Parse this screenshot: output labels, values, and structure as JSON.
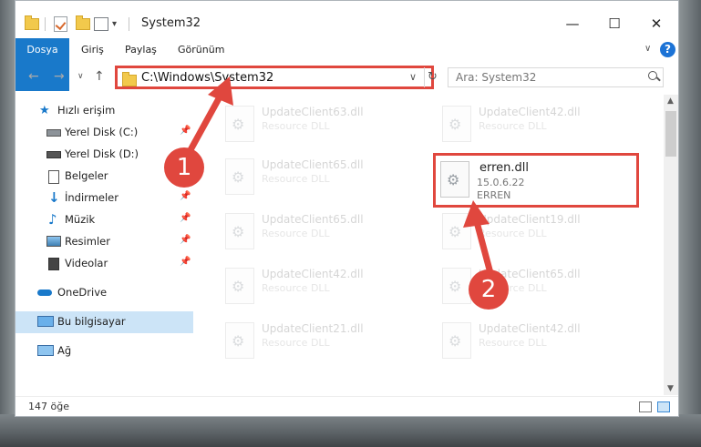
{
  "window": {
    "title": "System32"
  },
  "window_controls": {
    "minimize": "—",
    "maximize": "☐",
    "close": "✕"
  },
  "ribbon": {
    "tabs": [
      "Dosya",
      "Giriş",
      "Paylaş",
      "Görünüm"
    ],
    "help": "?",
    "expand": "∨"
  },
  "address": {
    "path": "C:\\Windows\\System32",
    "dropdown": "∨",
    "refresh": "↻"
  },
  "nav_buttons": {
    "back": "←",
    "forward": "→",
    "recent": "∨",
    "up": "↑"
  },
  "search": {
    "placeholder": "Ara: System32"
  },
  "nav_pane": {
    "quick_access": "Hızlı erişim",
    "items": [
      {
        "label": "Yerel Disk (C:)",
        "pinned": true
      },
      {
        "label": "Yerel Disk (D:)",
        "pinned": false
      },
      {
        "label": "Belgeler",
        "pinned": true
      },
      {
        "label": "İndirmeler",
        "pinned": true
      },
      {
        "label": "Müzik",
        "pinned": true
      },
      {
        "label": "Resimler",
        "pinned": true
      },
      {
        "label": "Videolar",
        "pinned": true
      }
    ],
    "onedrive": "OneDrive",
    "this_pc": "Bu bilgisayar",
    "network": "Ağ"
  },
  "files": {
    "left_col": [
      {
        "name": "UpdateClient63.dll",
        "type": "Resource DLL"
      },
      {
        "name": "UpdateClient65.dll",
        "type": "Resource DLL"
      },
      {
        "name": "UpdateClient65.dll",
        "type": "Resource DLL"
      },
      {
        "name": "UpdateClient42.dll",
        "type": "Resource DLL"
      },
      {
        "name": "UpdateClient21.dll",
        "type": "Resource DLL"
      }
    ],
    "right_col": [
      {
        "name": "UpdateClient42.dll",
        "type": "Resource DLL"
      },
      {
        "name": "UpdateClient19.dll",
        "type": "Resource DLL"
      },
      {
        "name": "UpdateClient65.dll",
        "type": "Resource DLL"
      },
      {
        "name": "UpdateClient42.dll",
        "type": "Resource DLL"
      }
    ],
    "highlighted": {
      "name": "erren.dll",
      "version": "15.0.6.22",
      "company": "ERREN"
    }
  },
  "status": {
    "count": "147 öğe"
  },
  "callouts": [
    "1",
    "2"
  ],
  "colors": {
    "highlight": "#e0473e",
    "accent": "#1979ca",
    "selection": "#cce4f7"
  }
}
